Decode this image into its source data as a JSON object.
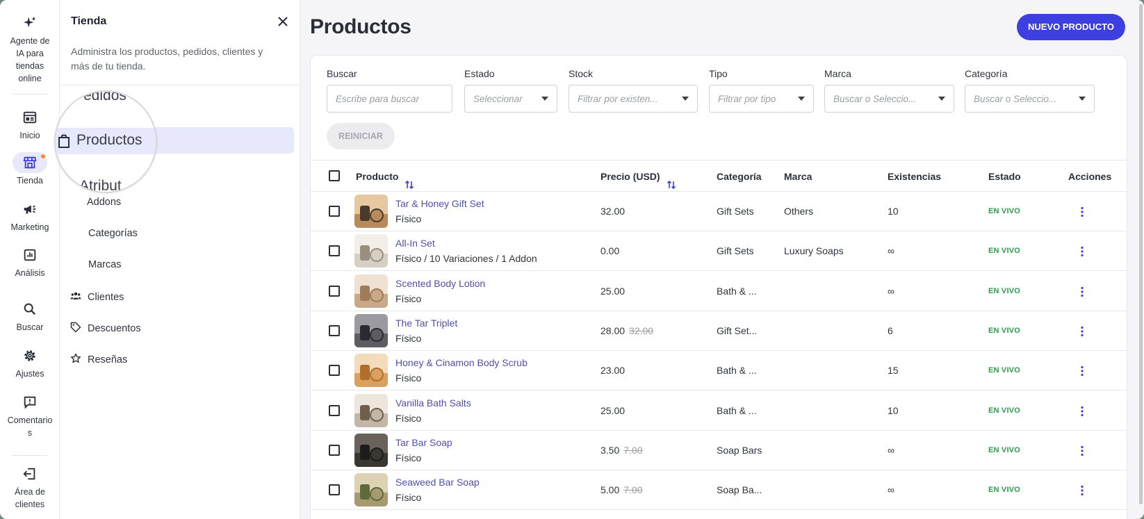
{
  "rail": {
    "items": [
      {
        "label": "Agente de IA para tiendas online",
        "icon": "sparkle-icon"
      },
      {
        "label": "Inicio",
        "icon": "dashboard-icon"
      },
      {
        "label": "Tienda",
        "icon": "store-icon"
      },
      {
        "label": "Marketing",
        "icon": "megaphone-icon"
      },
      {
        "label": "Análisis",
        "icon": "chart-icon"
      },
      {
        "label": "Buscar",
        "icon": "search-icon"
      },
      {
        "label": "Ajustes",
        "icon": "gear-icon"
      },
      {
        "label": "Comentarios",
        "icon": "feedback-icon"
      },
      {
        "label": "Área de clientes",
        "icon": "exit-icon"
      }
    ],
    "accent_color": "#3d3fe0",
    "notification_color": "#f08c3a"
  },
  "panel": {
    "title": "Tienda",
    "description": "Administra los productos, pedidos, clientes y más de tu tienda.",
    "nav": [
      {
        "label": "Pedidos",
        "icon": "receipt-icon"
      },
      {
        "label": "Productos",
        "icon": "bag-icon"
      },
      {
        "label": "Atributos",
        "icon": ""
      },
      {
        "label": "Addons",
        "icon": ""
      },
      {
        "label": "Categorías",
        "icon": ""
      },
      {
        "label": "Marcas",
        "icon": ""
      },
      {
        "label": "Clientes",
        "icon": "users-icon"
      },
      {
        "label": "Descuentos",
        "icon": "tag-icon"
      },
      {
        "label": "Reseñas",
        "icon": "star-icon"
      }
    ],
    "magnifier": {
      "top_text": "edidos",
      "main_text": "Productos",
      "bottom_text": "Atribut"
    }
  },
  "main": {
    "title": "Productos",
    "new_button": "NUEVO PRODUCTO",
    "reset_button": "REINICIAR",
    "filters": [
      {
        "label": "Buscar",
        "placeholder": "Escribe para buscar",
        "dropdown": false
      },
      {
        "label": "Estado",
        "placeholder": "Seleccionar",
        "dropdown": true
      },
      {
        "label": "Stock",
        "placeholder": "Filtrar por existen...",
        "dropdown": true
      },
      {
        "label": "Tipo",
        "placeholder": "Filtrar por tipo",
        "dropdown": true
      },
      {
        "label": "Marca",
        "placeholder": "Buscar o Seleccio...",
        "dropdown": true
      },
      {
        "label": "Categoría",
        "placeholder": "Buscar o Seleccio...",
        "dropdown": true
      }
    ],
    "columns": {
      "product": "Producto",
      "price": "Precio (USD)",
      "category": "Categoría",
      "brand": "Marca",
      "stock": "Existencias",
      "status": "Estado",
      "actions": "Acciones"
    },
    "status_color": "#2f9a4e",
    "link_color": "#4d4fb0",
    "rows": [
      {
        "name": "Tar & Honey Gift Set",
        "type": "Físico",
        "price": "32.00",
        "old_price": "",
        "category": "Gift Sets",
        "brand": "Others",
        "stock": "10",
        "status": "EN VIVO"
      },
      {
        "name": "All-In Set",
        "type": "Físico / 10 Variaciones / 1 Addon",
        "price": "0.00",
        "old_price": "",
        "category": "Gift Sets",
        "brand": "Luxury Soaps",
        "stock": "∞",
        "status": "EN VIVO"
      },
      {
        "name": "Scented Body Lotion",
        "type": "Físico",
        "price": "25.00",
        "old_price": "",
        "category": "Bath & ...",
        "brand": "",
        "stock": "∞",
        "status": "EN VIVO"
      },
      {
        "name": "The Tar Triplet",
        "type": "Físico",
        "price": "28.00",
        "old_price": "32.00",
        "category": "Gift Set...",
        "brand": "",
        "stock": "6",
        "status": "EN VIVO"
      },
      {
        "name": "Honey & Cinamon Body Scrub",
        "type": "Físico",
        "price": "23.00",
        "old_price": "",
        "category": "Bath & ...",
        "brand": "",
        "stock": "15",
        "status": "EN VIVO"
      },
      {
        "name": "Vanilla Bath Salts",
        "type": "Físico",
        "price": "25.00",
        "old_price": "",
        "category": "Bath & ...",
        "brand": "",
        "stock": "10",
        "status": "EN VIVO"
      },
      {
        "name": "Tar Bar Soap",
        "type": "Físico",
        "price": "3.50",
        "old_price": "7.00",
        "category": "Soap Bars",
        "brand": "",
        "stock": "∞",
        "status": "EN VIVO"
      },
      {
        "name": "Seaweed Bar Soap",
        "type": "Físico",
        "price": "5.00",
        "old_price": "7.00",
        "category": "Soap Ba...",
        "brand": "",
        "stock": "∞",
        "status": "EN VIVO"
      }
    ]
  }
}
